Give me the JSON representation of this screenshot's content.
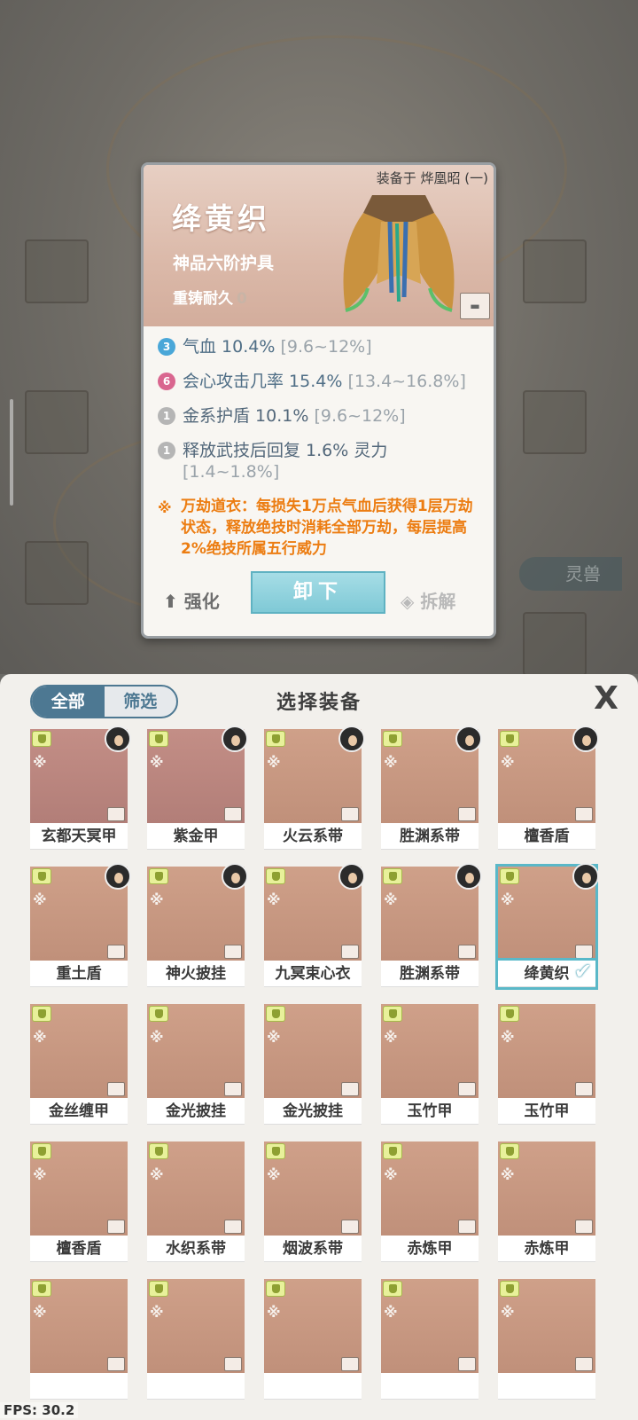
{
  "detail": {
    "equipped_on": "装备于 烨凰昭 (一)",
    "name": "绛黄织",
    "grade": "神品六阶护具",
    "durability_label": "重铸耐久",
    "durability_value": "0",
    "attributes": [
      {
        "badge": "3",
        "badge_color": "#4aa7d8",
        "text": "气血 10.4% ",
        "range": "[9.6~12%]"
      },
      {
        "badge": "6",
        "badge_color": "#d9668f",
        "text": "会心攻击几率 15.4% ",
        "range": "[13.4~16.8%]"
      },
      {
        "badge": "1",
        "badge_color": "#b5b5b5",
        "text": "金系护盾 10.1% ",
        "range": "[9.6~12%]"
      },
      {
        "badge": "1",
        "badge_color": "#b5b5b5",
        "text": "释放武技后回复 1.6% 灵力 ",
        "range": "[1.4~1.8%]"
      }
    ],
    "special_text": "万劫道衣：每损失1万点气血后获得1层万劫状态，释放绝技时消耗全部万劫，每层提高2%绝技所属五行威力",
    "strengthen_label": "强化",
    "unequip_label": "卸下",
    "dismantle_label": "拆解"
  },
  "background": {
    "tag_label": "灵兽"
  },
  "panel": {
    "tab_all": "全部",
    "tab_filter": "筛选",
    "title": "选择装备",
    "close_icon": "X"
  },
  "items": [
    {
      "label": "玄都天冥甲",
      "style": "purple",
      "avatar": true
    },
    {
      "label": "紫金甲",
      "style": "purple",
      "avatar": true
    },
    {
      "label": "火云系带",
      "style": "normal",
      "avatar": true
    },
    {
      "label": "胜渊系带",
      "style": "normal",
      "avatar": true
    },
    {
      "label": "檀香盾",
      "style": "normal",
      "avatar": true
    },
    {
      "label": "重土盾",
      "style": "normal",
      "avatar": true
    },
    {
      "label": "神火披挂",
      "style": "normal",
      "avatar": true
    },
    {
      "label": "九冥束心衣",
      "style": "normal",
      "avatar": true
    },
    {
      "label": "胜渊系带",
      "style": "normal",
      "avatar": true
    },
    {
      "label": "绛黄织",
      "style": "normal",
      "avatar": true,
      "selected": true
    },
    {
      "label": "金丝缠甲",
      "style": "normal"
    },
    {
      "label": "金光披挂",
      "style": "normal"
    },
    {
      "label": "金光披挂",
      "style": "normal"
    },
    {
      "label": "玉竹甲",
      "style": "normal"
    },
    {
      "label": "玉竹甲",
      "style": "normal"
    },
    {
      "label": "檀香盾",
      "style": "normal"
    },
    {
      "label": "水织系带",
      "style": "normal"
    },
    {
      "label": "烟波系带",
      "style": "normal"
    },
    {
      "label": "赤炼甲",
      "style": "normal"
    },
    {
      "label": "赤炼甲",
      "style": "normal"
    },
    {
      "label": "",
      "style": "normal"
    },
    {
      "label": "",
      "style": "normal"
    },
    {
      "label": "",
      "style": "normal"
    },
    {
      "label": "",
      "style": "normal"
    },
    {
      "label": "",
      "style": "normal"
    }
  ],
  "fps": "FPS: 30.2"
}
